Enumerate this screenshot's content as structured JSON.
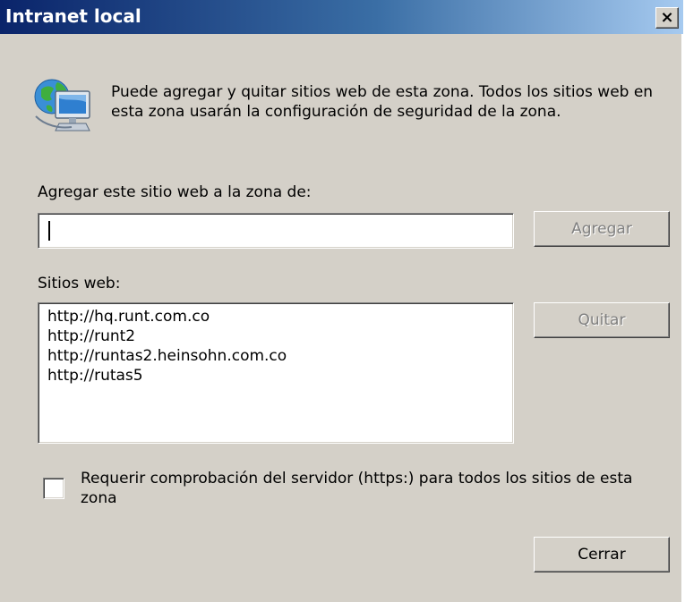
{
  "window": {
    "title": "Intranet local",
    "close_glyph": "×"
  },
  "dialog": {
    "icon": "globe-computer-icon",
    "description": "Puede agregar y quitar sitios web de esta zona. Todos los sitios web en esta zona usarán la configuración de seguridad de la zona.",
    "add_label": "Agregar este sitio web a la zona de:",
    "url_input_value": "",
    "add_button": "Agregar",
    "sites_label": "Sitios web:",
    "sites": [
      "http://hq.runt.com.co",
      "http://runt2",
      "http://runtas2.heinsohn.com.co",
      "http://rutas5"
    ],
    "remove_button": "Quitar",
    "require_https_label": "Requerir comprobación del servidor (https:) para todos los sitios de esta zona",
    "require_https_checked": false,
    "close_button": "Cerrar"
  },
  "colors": {
    "titlebar_start": "#0a246a",
    "titlebar_end": "#a6caf0",
    "face": "#d4d0c8",
    "disabled_text": "#808080"
  }
}
